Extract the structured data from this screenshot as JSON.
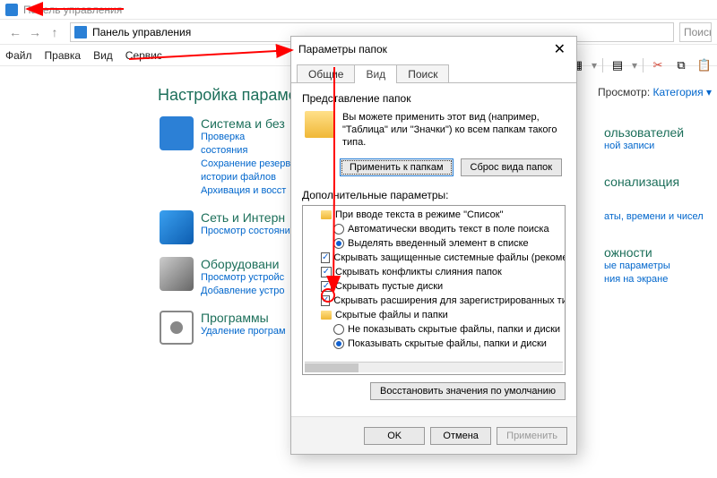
{
  "window": {
    "title": "Панель управления"
  },
  "nav": {
    "breadcrumb": "Панель управления",
    "search_placeholder": "Поиск"
  },
  "menu": {
    "file": "Файл",
    "edit": "Правка",
    "view": "Вид",
    "tools": "Сервис"
  },
  "viewbar": {
    "label": "Просмотр:",
    "value": "Категория"
  },
  "heading": "Настройка параметров",
  "categories": [
    {
      "title": "Система и без",
      "links": [
        "Проверка состояния",
        "Сохранение резерв",
        "истории файлов",
        "Архивация и восст"
      ]
    },
    {
      "title": "Сеть и Интерн",
      "links": [
        "Просмотр состояни"
      ]
    },
    {
      "title": "Оборудовани",
      "links": [
        "Просмотр устройс",
        "Добавление устро"
      ]
    },
    {
      "title": "Программы",
      "links": [
        "Удаление програм"
      ]
    }
  ],
  "rightlinks": [
    {
      "title": "ользователей",
      "links": [
        "ной записи"
      ]
    },
    {
      "title": "сонализация",
      "links": []
    },
    {
      "title": "",
      "links": [
        "аты, времени и чисел"
      ]
    },
    {
      "title": "ожности",
      "links": [
        "ые параметры",
        "ния на экране"
      ]
    }
  ],
  "dialog": {
    "title": "Параметры папок",
    "tabs": {
      "general": "Общие",
      "view": "Вид",
      "search": "Поиск"
    },
    "folderview": {
      "group": "Представление папок",
      "text": "Вы можете применить этот вид (например, \"Таблица\" или \"Значки\") ко всем папкам такого типа.",
      "apply": "Применить к папкам",
      "reset": "Сброс вида папок"
    },
    "adv": {
      "group": "Дополнительные параметры:",
      "items": [
        {
          "kind": "folder",
          "label": "При вводе текста в режиме \"Список\"",
          "indent": 1
        },
        {
          "kind": "radio",
          "on": false,
          "label": "Автоматически вводить текст в поле поиска",
          "indent": 2
        },
        {
          "kind": "radio",
          "on": true,
          "label": "Выделять введенный элемент в списке",
          "indent": 2
        },
        {
          "kind": "check",
          "on": true,
          "label": "Скрывать защищенные системные файлы (рекомен.",
          "indent": 1
        },
        {
          "kind": "check",
          "on": true,
          "label": "Скрывать конфликты слияния папок",
          "indent": 1
        },
        {
          "kind": "check",
          "on": true,
          "label": "Скрывать пустые диски",
          "indent": 1
        },
        {
          "kind": "check",
          "on": true,
          "label": "Скрывать расширения для зарегистрированных типо",
          "indent": 1
        },
        {
          "kind": "folder",
          "label": "Скрытые файлы и папки",
          "indent": 1
        },
        {
          "kind": "radio",
          "on": false,
          "label": "Не показывать скрытые файлы, папки и диски",
          "indent": 2,
          "mark": true
        },
        {
          "kind": "radio",
          "on": true,
          "label": "Показывать скрытые файлы, папки и диски",
          "indent": 2
        }
      ],
      "restore": "Восстановить значения по умолчанию"
    },
    "buttons": {
      "ok": "OK",
      "cancel": "Отмена",
      "apply": "Применить"
    }
  }
}
